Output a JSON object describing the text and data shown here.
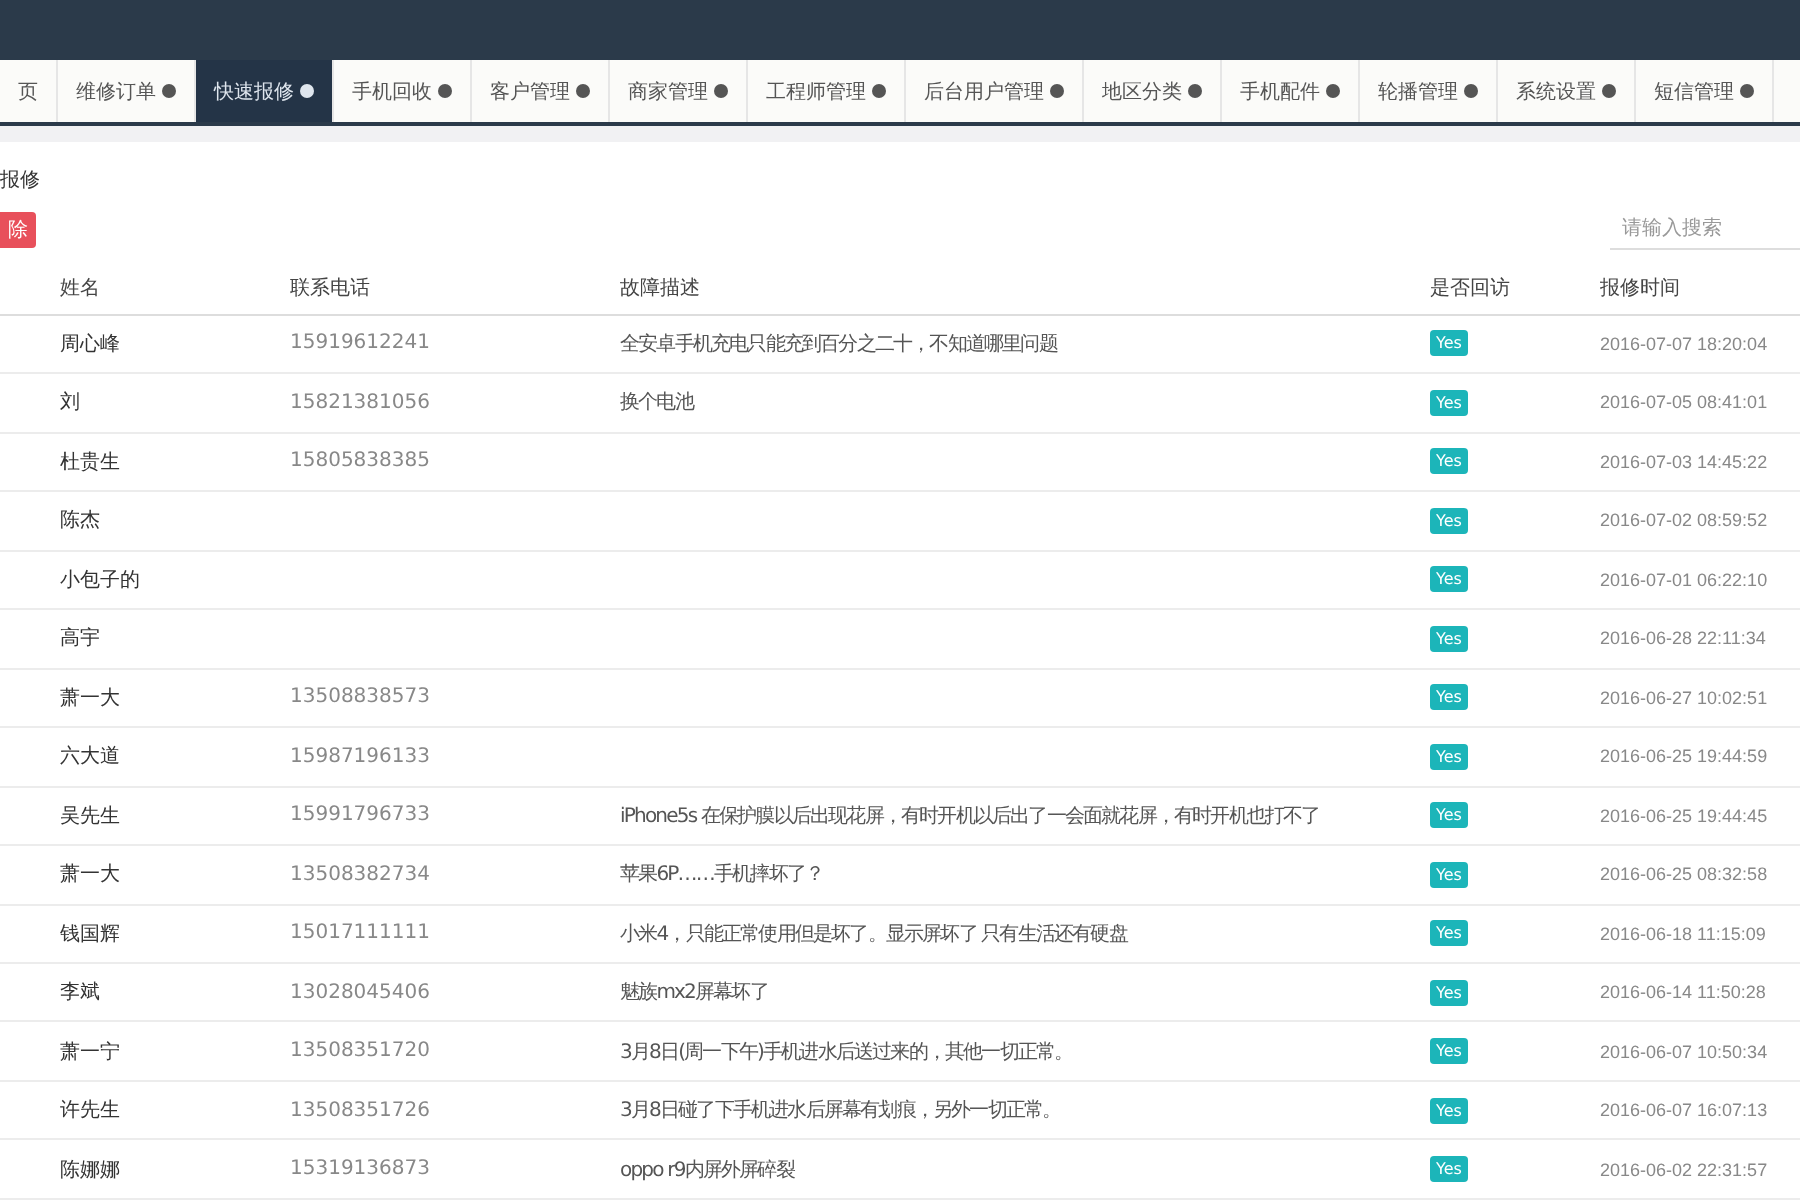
{
  "tabs": [
    {
      "label": "页",
      "selected": false,
      "badge": false
    },
    {
      "label": "维修订单",
      "selected": false,
      "badge": true
    },
    {
      "label": "快速报修",
      "selected": true,
      "badge": true
    },
    {
      "label": "手机回收",
      "selected": false,
      "badge": true
    },
    {
      "label": "客户管理",
      "selected": false,
      "badge": true
    },
    {
      "label": "商家管理",
      "selected": false,
      "badge": true
    },
    {
      "label": "工程师管理",
      "selected": false,
      "badge": true
    },
    {
      "label": "后台用户管理",
      "selected": false,
      "badge": true
    },
    {
      "label": "地区分类",
      "selected": false,
      "badge": true
    },
    {
      "label": "手机配件",
      "selected": false,
      "badge": true
    },
    {
      "label": "轮播管理",
      "selected": false,
      "badge": true
    },
    {
      "label": "系统设置",
      "selected": false,
      "badge": true
    },
    {
      "label": "短信管理",
      "selected": false,
      "badge": true
    }
  ],
  "page_title": "报修",
  "delete_button": "除",
  "search": {
    "placeholder": "请输入搜索"
  },
  "table": {
    "columns": [
      "姓名",
      "联系电话",
      "故障描述",
      "是否回访",
      "报修时间"
    ],
    "rows": [
      {
        "name": "周心峰",
        "phone": "15919612241",
        "description": "全安卓手机充电只能充到百分之二十，不知道哪里问题",
        "visited": "Yes",
        "time": "2016-07-07 18:20:04"
      },
      {
        "name": "刘",
        "phone": "15821381056",
        "description": "换个电池",
        "visited": "Yes",
        "time": "2016-07-05 08:41:01"
      },
      {
        "name": "杜贵生",
        "phone": "15805838385",
        "visited": "Yes",
        "time": "2016-07-03 14:45:22"
      },
      {
        "name": "陈杰",
        "visited": "Yes",
        "time": "2016-07-02 08:59:52"
      },
      {
        "name": "小包子的",
        "visited": "Yes",
        "time": "2016-07-01 06:22:10"
      },
      {
        "name": "高宇",
        "visited": "Yes",
        "time": "2016-06-28 22:11:34"
      },
      {
        "name": "萧一大",
        "phone": "13508838573",
        "visited": "Yes",
        "time": "2016-06-27 10:02:51"
      },
      {
        "name": "六大道",
        "phone": "15987196133",
        "visited": "Yes",
        "time": "2016-06-25 19:44:59"
      },
      {
        "name": "吴先生",
        "phone": "15991796733",
        "description": "iPhone5s 在保护膜以后出现花屏，有时开机以后出了一会面就花屏，有时开机也打不了",
        "visited": "Yes",
        "time": "2016-06-25 19:44:45"
      },
      {
        "name": "萧一大",
        "phone": "13508382734",
        "description": "苹果6P……手机摔坏了？",
        "visited": "Yes",
        "time": "2016-06-25 08:32:58"
      },
      {
        "name": "钱国辉",
        "phone": "15017111111",
        "description": "小米4，只能正常使用但是坏了。显示屏坏了 只有生活还有硬盘",
        "visited": "Yes",
        "time": "2016-06-18 11:15:09"
      },
      {
        "name": "李斌",
        "phone": "13028045406",
        "description": "魅族mx2屏幕坏了",
        "visited": "Yes",
        "time": "2016-06-14 11:50:28"
      },
      {
        "name": "萧一宁",
        "phone": "13508351720",
        "description": "3月8日(周一下午)手机进水后送过来的，其他一切正常。",
        "visited": "Yes",
        "time": "2016-06-07 10:50:34"
      },
      {
        "name": "许先生",
        "phone": "13508351726",
        "description": "3月8日碰了下手机进水后屏幕有划痕，另外一切正常。",
        "visited": "Yes",
        "time": "2016-06-07 16:07:13"
      },
      {
        "name": "陈娜娜",
        "phone": "15319136873",
        "description": "oppo r9内屏外屏碎裂",
        "visited": "Yes",
        "time": "2016-06-02 22:31:57"
      }
    ]
  }
}
